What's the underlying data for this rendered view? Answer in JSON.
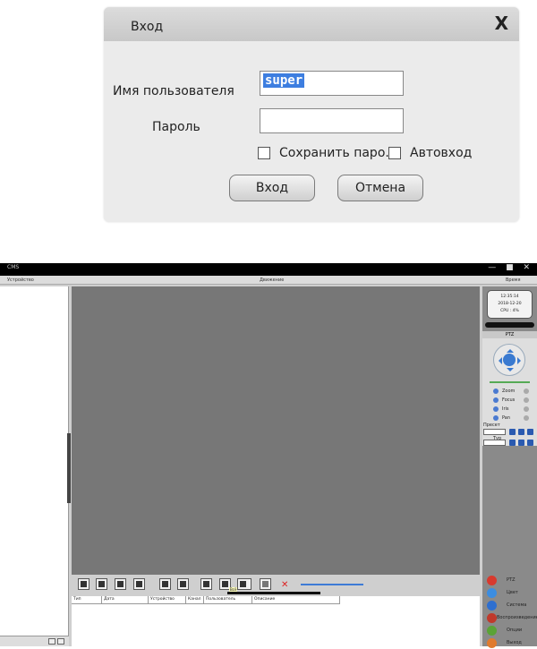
{
  "login": {
    "title": "Вход",
    "close": "X",
    "username_label": "Имя пользователя",
    "username_value": "super",
    "password_label": "Пароль",
    "password_value": "",
    "save_password_label": "Сохранить паро.",
    "autologin_label": "Автовход",
    "login_button": "Вход",
    "cancel_button": "Отмена"
  },
  "app": {
    "title": "CMS",
    "window_controls": "— ■ ✕",
    "menu": {
      "left": "Устройство",
      "center": "Движение",
      "right": "Время"
    },
    "clock": {
      "time": "12:35:14",
      "date": "2018-12-20",
      "cpu": "CPU : 4%"
    },
    "ptz": {
      "header": "PTZ",
      "rows": [
        "Zoom",
        "Focus",
        "Iris",
        "Pan"
      ],
      "preset_label": "Пресет",
      "tour_label": "Тур"
    },
    "side_buttons": [
      {
        "label": "PTZ",
        "color": "#d83a2e"
      },
      {
        "label": "Цвет",
        "color": "#3c8de0"
      },
      {
        "label": "Система",
        "color": "#2e6fd0"
      },
      {
        "label": "Воспроизведение",
        "color": "#c0392b"
      },
      {
        "label": "Опции",
        "color": "#5aa336"
      },
      {
        "label": "Выход",
        "color": "#e07b2e"
      }
    ],
    "toolbar": {
      "active_label": "Всё"
    },
    "log_columns": [
      "Тип",
      "Дата",
      "Устройство",
      "Канал",
      "Пользователь",
      "Описание"
    ]
  }
}
